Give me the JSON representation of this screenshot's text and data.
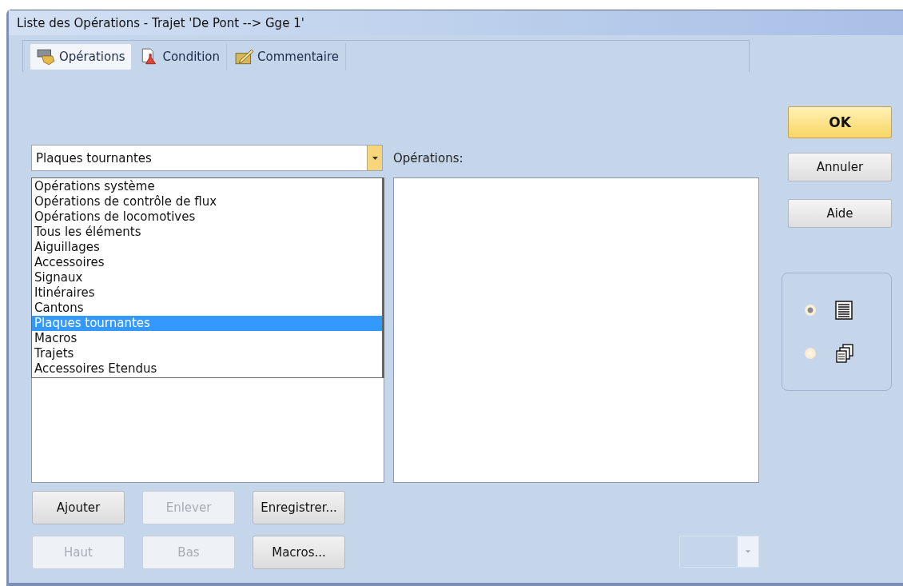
{
  "window": {
    "title": "Liste des Opérations - Trajet 'De Pont --> Gge 1'"
  },
  "tabs": [
    {
      "label": "Opérations",
      "kind": "operations",
      "selected": true
    },
    {
      "label": "Condition",
      "kind": "condition",
      "selected": false
    },
    {
      "label": "Commentaire",
      "kind": "comment",
      "selected": false
    }
  ],
  "category_combo": {
    "value": "Plaques tournantes",
    "open": true
  },
  "category_options": [
    {
      "label": "Opérations système",
      "selected": false
    },
    {
      "label": "Opérations de contrôle de flux",
      "selected": false
    },
    {
      "label": "Opérations de locomotives",
      "selected": false
    },
    {
      "label": "Tous les éléments",
      "selected": false
    },
    {
      "label": "Aiguillages",
      "selected": false
    },
    {
      "label": "Accessoires",
      "selected": false
    },
    {
      "label": "Signaux",
      "selected": false
    },
    {
      "label": "Itinéraires",
      "selected": false
    },
    {
      "label": "Cantons",
      "selected": false
    },
    {
      "label": "Plaques tournantes",
      "selected": true
    },
    {
      "label": "Macros",
      "selected": false
    },
    {
      "label": "Trajets",
      "selected": false
    },
    {
      "label": "Accessoires Etendus",
      "selected": false
    }
  ],
  "operations_label": "Opérations:",
  "dialog_buttons": [
    {
      "label": "OK",
      "default": true
    },
    {
      "label": "Annuler",
      "default": false
    },
    {
      "label": "Aide",
      "default": false
    }
  ],
  "list_buttons": [
    {
      "label": "Ajouter",
      "disabled": false
    },
    {
      "label": "Enlever",
      "disabled": true
    },
    {
      "label": "Enregistrer...",
      "disabled": false
    },
    {
      "label": "Haut",
      "disabled": true
    },
    {
      "label": "Bas",
      "disabled": true
    },
    {
      "label": "Macros...",
      "disabled": false
    }
  ],
  "view_options": [
    {
      "kind": "list",
      "selected": true
    },
    {
      "kind": "cascade",
      "selected": false
    }
  ],
  "small_combo": {
    "disabled": true
  }
}
